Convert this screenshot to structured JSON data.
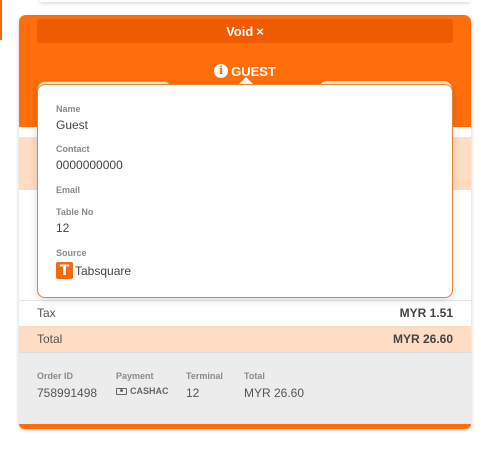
{
  "header": {
    "void_label": "Void",
    "void_icon": "×",
    "guest_label": "GUEST"
  },
  "guest_popover": {
    "name_label": "Name",
    "name_value": "Guest",
    "contact_label": "Contact",
    "contact_value": "0000000000",
    "email_label": "Email",
    "email_value": "",
    "table_label": "Table No",
    "table_value": "12",
    "source_label": "Source",
    "source_value": "Tabsquare"
  },
  "summary": {
    "tax_label": "Tax",
    "tax_value": "MYR 1.51",
    "total_label": "Total",
    "total_value": "MYR 26.60"
  },
  "footer": {
    "order_id_label": "Order ID",
    "order_id_value": "758991498",
    "payment_label": "Payment",
    "payment_value": "CASHAC",
    "terminal_label": "Terminal",
    "terminal_value": "12",
    "total_label": "Total",
    "total_value": "MYR 26.60"
  },
  "colors": {
    "brand_orange": "#ff6e0a",
    "void_bar": "#f05a00",
    "peach": "#ffdcc4"
  },
  "icons": {
    "info": "info-icon",
    "close": "close-icon",
    "cash": "cash-icon",
    "source_logo": "tabsquare-logo-icon"
  }
}
